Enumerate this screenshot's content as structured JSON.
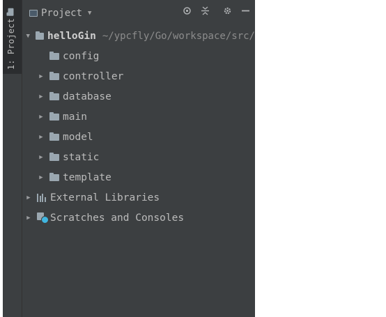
{
  "side_stripe": {
    "tab_label": "1: Project"
  },
  "header": {
    "view_label": "Project",
    "tools": [
      "locate-icon",
      "collapse-all-icon",
      "gear-icon",
      "hide-icon"
    ]
  },
  "tree": {
    "root": {
      "name": "helloGin",
      "path": "~/ypcfly/Go/workspace/src/"
    },
    "children": [
      {
        "label": "config",
        "expandable": false
      },
      {
        "label": "controller",
        "expandable": true
      },
      {
        "label": "database",
        "expandable": true
      },
      {
        "label": "main",
        "expandable": true
      },
      {
        "label": "model",
        "expandable": true
      },
      {
        "label": "static",
        "expandable": true
      },
      {
        "label": "template",
        "expandable": true
      }
    ],
    "external_libraries": "External Libraries",
    "scratches": "Scratches and Consoles"
  },
  "colors": {
    "panel_bg": "#3c3f41",
    "text": "#bbbbbb",
    "path_text": "#8c8c8c",
    "folder_icon": "#9aa7b0",
    "scratch_clock": "#40b6e0"
  }
}
